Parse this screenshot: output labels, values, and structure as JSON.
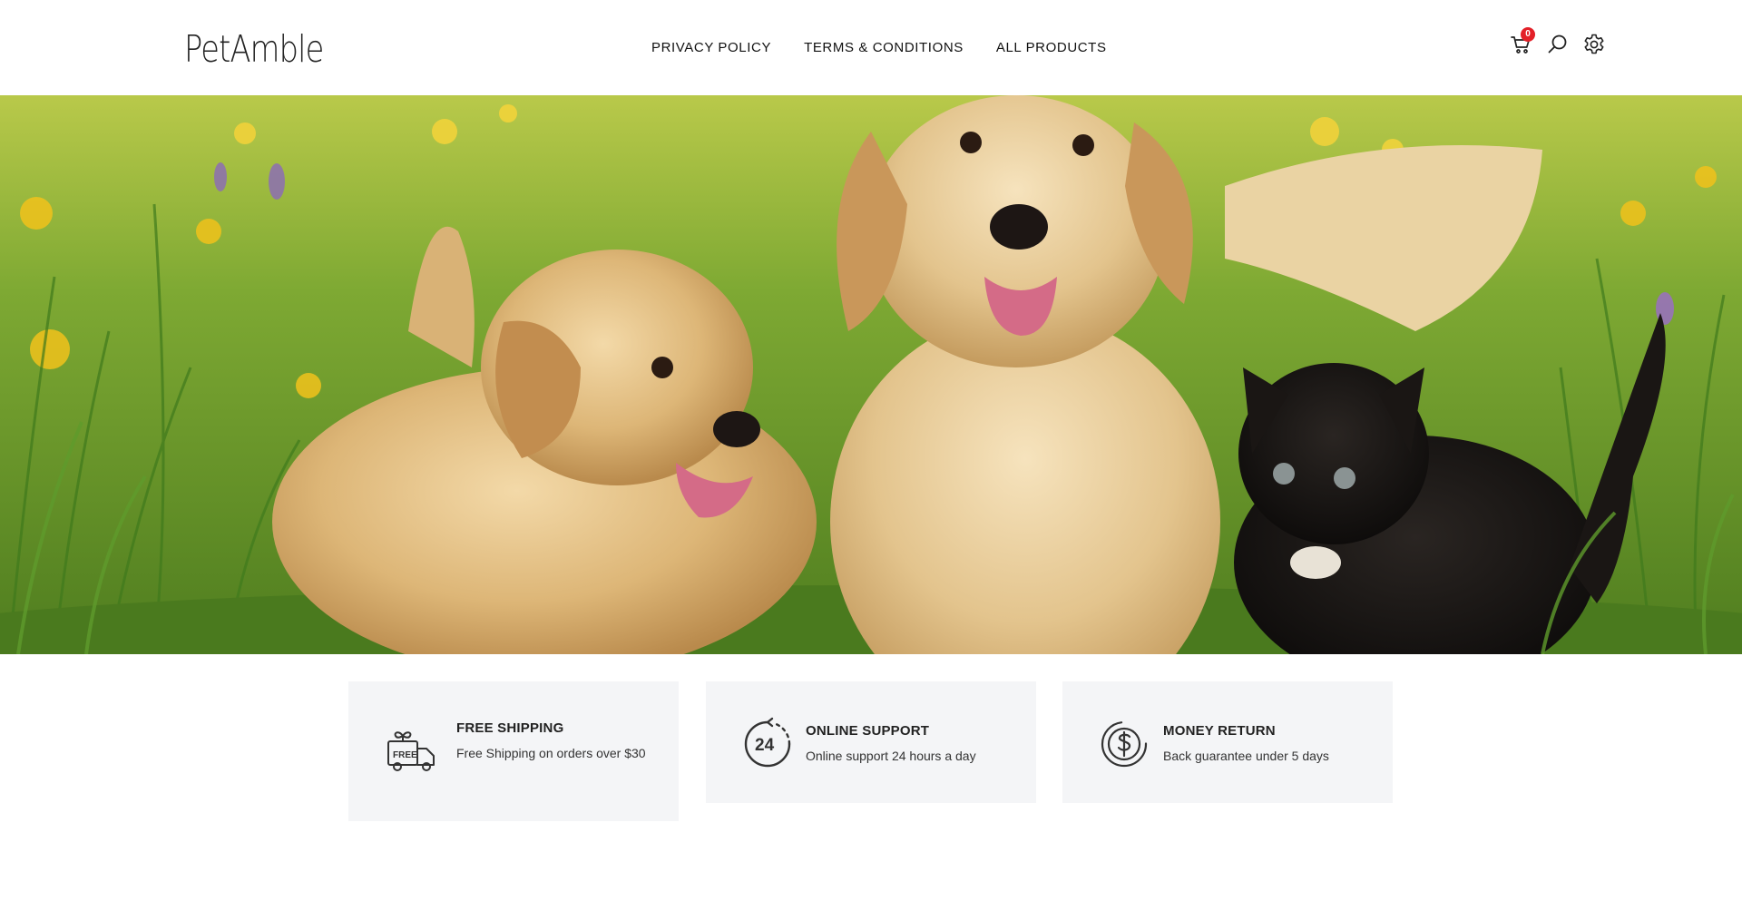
{
  "brand": {
    "logo_text": "PetAmble"
  },
  "nav": {
    "items": [
      {
        "label": "PRIVACY POLICY"
      },
      {
        "label": "TERMS & CONDITIONS"
      },
      {
        "label": "ALL PRODUCTS"
      }
    ]
  },
  "header_icons": {
    "cart": {
      "icon": "cart-icon",
      "badge_count": "0"
    },
    "search": {
      "icon": "search-icon"
    },
    "settings": {
      "icon": "gear-icon"
    }
  },
  "hero": {
    "image": "puppies-and-kitten-in-grass",
    "alt": ""
  },
  "features": [
    {
      "icon": "free-delivery-truck-icon",
      "title": "FREE SHIPPING",
      "description": "Free Shipping on orders over $30"
    },
    {
      "icon": "24-hour-support-icon",
      "title": "ONLINE SUPPORT",
      "description": "Online support 24 hours a day"
    },
    {
      "icon": "money-return-icon",
      "title": "MONEY RETURN",
      "description": "Back guarantee under 5 days"
    }
  ],
  "colors": {
    "badge": "#e32028",
    "feature_bg": "#f4f5f7",
    "text": "#222222",
    "grass": "#5f8f2a"
  }
}
